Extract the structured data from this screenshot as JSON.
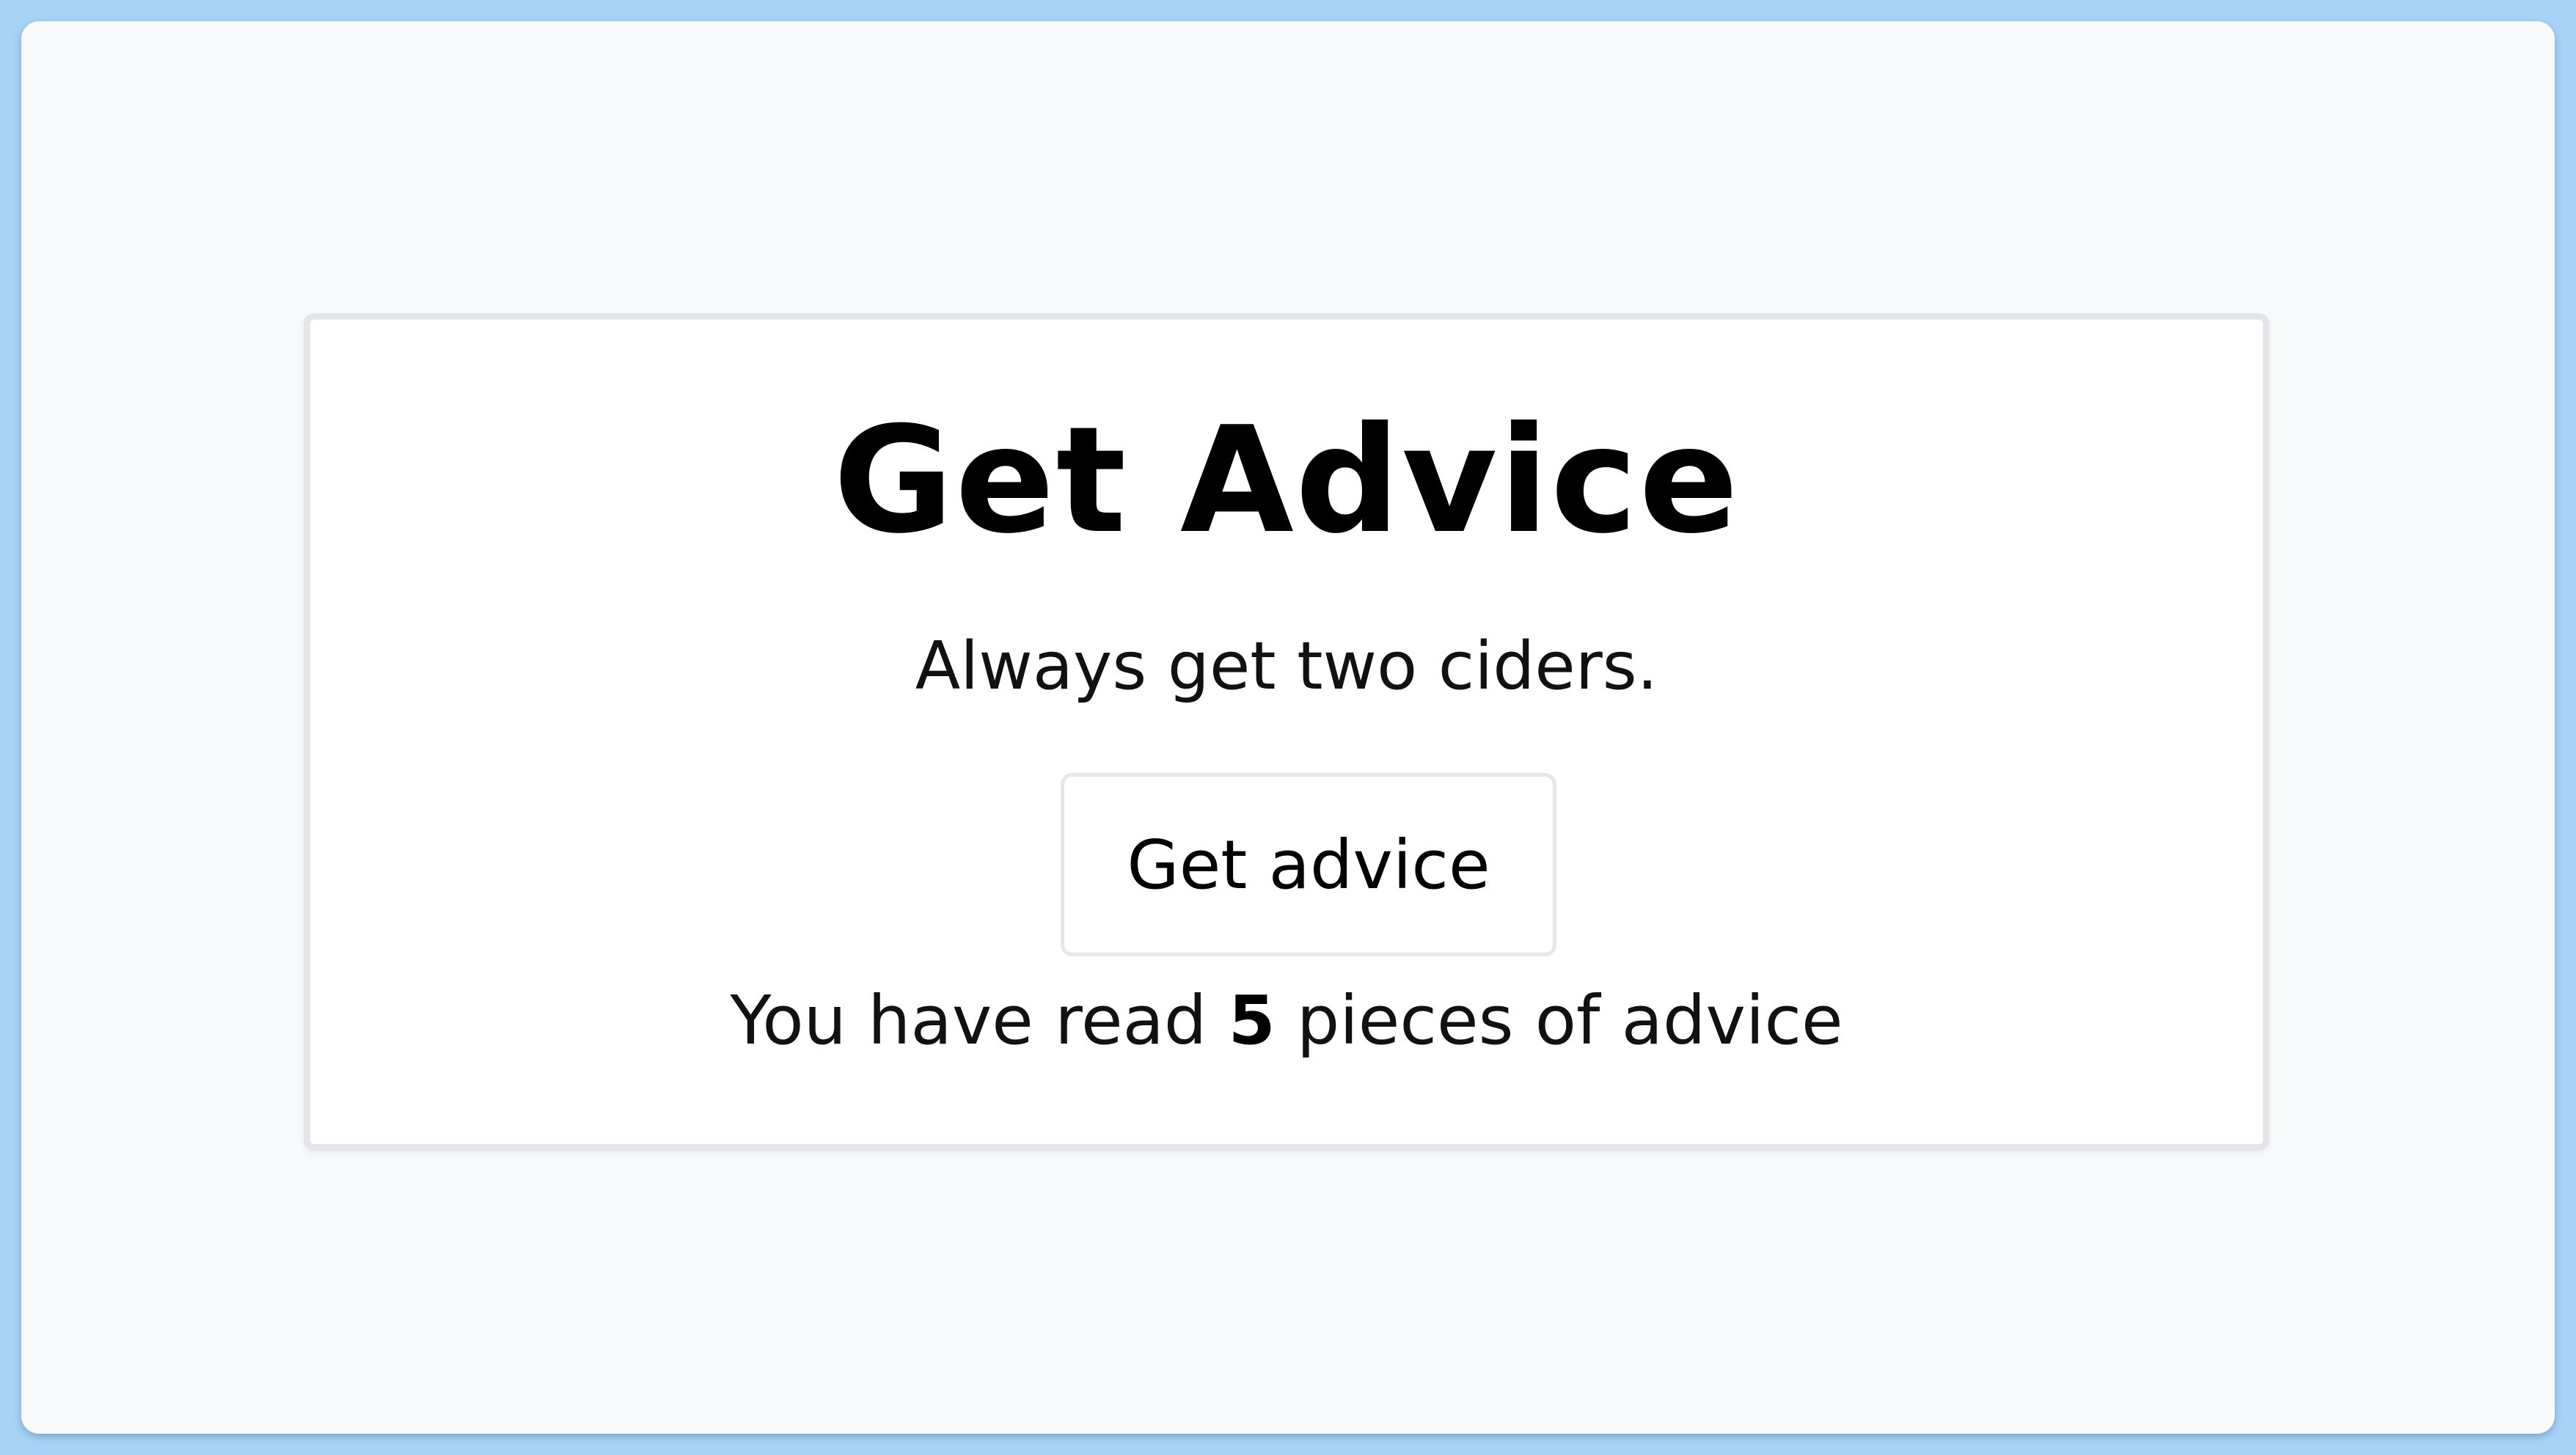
{
  "card": {
    "title": "Get Advice",
    "advice_text": "Always get two ciders.",
    "button_label": "Get advice",
    "counter": {
      "prefix": "You have read ",
      "count": "5",
      "suffix": " pieces of advice"
    }
  },
  "colors": {
    "page_background": "#a8d2f6",
    "window_background": "#f8f9fb",
    "card_border": "#e3e5e8"
  }
}
